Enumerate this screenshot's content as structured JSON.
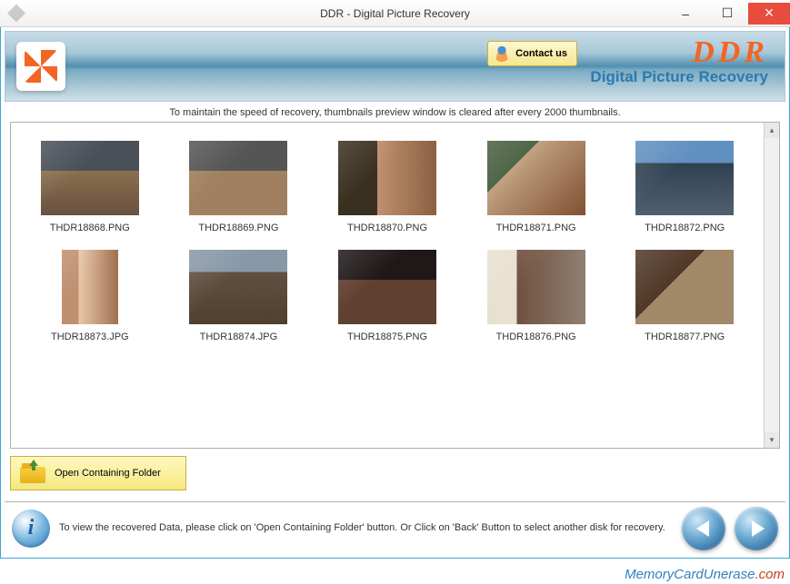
{
  "window": {
    "title": "DDR - Digital Picture Recovery"
  },
  "header": {
    "contact_label": "Contact us",
    "brand": "DDR",
    "brand_sub": "Digital Picture Recovery"
  },
  "info_bar": "To maintain the speed of recovery, thumbnails preview window is cleared after every 2000 thumbnails.",
  "thumbnails": [
    {
      "filename": "THDR18868.PNG"
    },
    {
      "filename": "THDR18869.PNG"
    },
    {
      "filename": "THDR18870.PNG"
    },
    {
      "filename": "THDR18871.PNG"
    },
    {
      "filename": "THDR18872.PNG"
    },
    {
      "filename": "THDR18873.JPG"
    },
    {
      "filename": "THDR18874.JPG"
    },
    {
      "filename": "THDR18875.PNG"
    },
    {
      "filename": "THDR18876.PNG"
    },
    {
      "filename": "THDR18877.PNG"
    }
  ],
  "open_folder_label": "Open Containing Folder",
  "bottom_help": "To view the recovered Data, please click on 'Open Containing Folder' button. Or Click on 'Back' Button to select another disk for recovery.",
  "watermark": {
    "main": "MemoryCardUnerase",
    "tld": ".com"
  }
}
